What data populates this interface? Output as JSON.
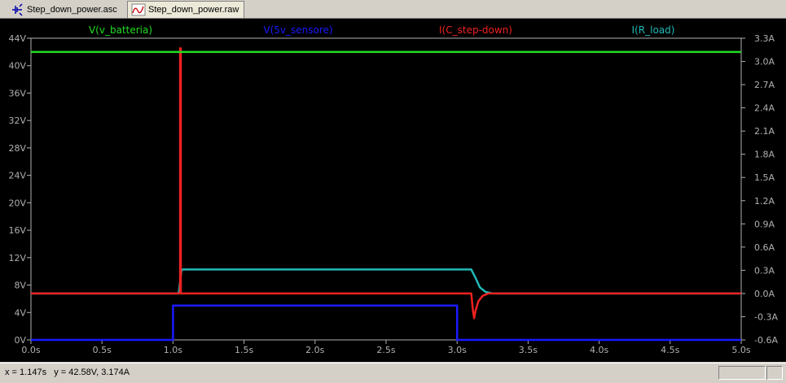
{
  "tabs": [
    {
      "label": "Step_down_power.asc",
      "icon": "schematic-icon",
      "active": false
    },
    {
      "label": "Step_down_power.raw",
      "icon": "waveform-icon",
      "active": true
    }
  ],
  "status": {
    "text": "x = 1.147s   y = 42.58V, 3.174A"
  },
  "colors": {
    "v_batteria": "#22dd22",
    "v_5v_sensore": "#1a1aff",
    "i_c_step_down": "#ee2222",
    "i_r_load": "#22b8b8"
  },
  "chart_data": {
    "type": "line",
    "background": "#000000",
    "grid": false,
    "x": {
      "ticks": [
        "0.0s",
        "0.5s",
        "1.0s",
        "1.5s",
        "2.0s",
        "2.5s",
        "3.0s",
        "3.5s",
        "4.0s",
        "4.5s",
        "5.0s"
      ],
      "range": [
        0,
        5
      ],
      "unit": "s"
    },
    "y_left": {
      "ticks": [
        "0V",
        "4V",
        "8V",
        "12V",
        "16V",
        "20V",
        "24V",
        "28V",
        "32V",
        "36V",
        "40V",
        "44V"
      ],
      "range": [
        0,
        44
      ],
      "unit": "V"
    },
    "y_right": {
      "ticks": [
        "-0.6A",
        "-0.3A",
        "0.0A",
        "0.3A",
        "0.6A",
        "0.9A",
        "1.2A",
        "1.5A",
        "1.8A",
        "2.1A",
        "2.4A",
        "2.7A",
        "3.0A",
        "3.3A"
      ],
      "range": [
        -0.6,
        3.3
      ],
      "unit": "A"
    },
    "series": [
      {
        "name": "V(v_batteria)",
        "axis": "left",
        "color": "#22dd22",
        "points": [
          [
            0,
            42
          ],
          [
            5,
            42
          ]
        ]
      },
      {
        "name": "V(5v_sensore)",
        "axis": "left",
        "color": "#1a1aff",
        "points": [
          [
            0,
            0
          ],
          [
            1,
            0
          ],
          [
            1,
            5
          ],
          [
            3,
            5
          ],
          [
            3,
            0
          ],
          [
            5,
            0
          ]
        ]
      },
      {
        "name": "I(C_step-down)",
        "axis": "right",
        "color": "#ee2222",
        "points": [
          [
            0,
            0
          ],
          [
            1.05,
            0
          ],
          [
            1.05,
            3.17
          ],
          [
            1.055,
            3.17
          ],
          [
            1.055,
            0
          ],
          [
            3.1,
            0
          ],
          [
            3.11,
            -0.2
          ],
          [
            3.12,
            -0.32
          ],
          [
            3.13,
            -0.22
          ],
          [
            3.15,
            -0.1
          ],
          [
            3.18,
            -0.03
          ],
          [
            3.22,
            0
          ],
          [
            5,
            0
          ]
        ]
      },
      {
        "name": "I(R_load)",
        "axis": "right",
        "color": "#22b8b8",
        "points": [
          [
            0,
            0
          ],
          [
            1.04,
            0
          ],
          [
            1.06,
            0.31
          ],
          [
            3.1,
            0.31
          ],
          [
            3.13,
            0.2
          ],
          [
            3.16,
            0.08
          ],
          [
            3.2,
            0.02
          ],
          [
            3.25,
            0
          ],
          [
            5,
            0
          ]
        ]
      }
    ]
  }
}
